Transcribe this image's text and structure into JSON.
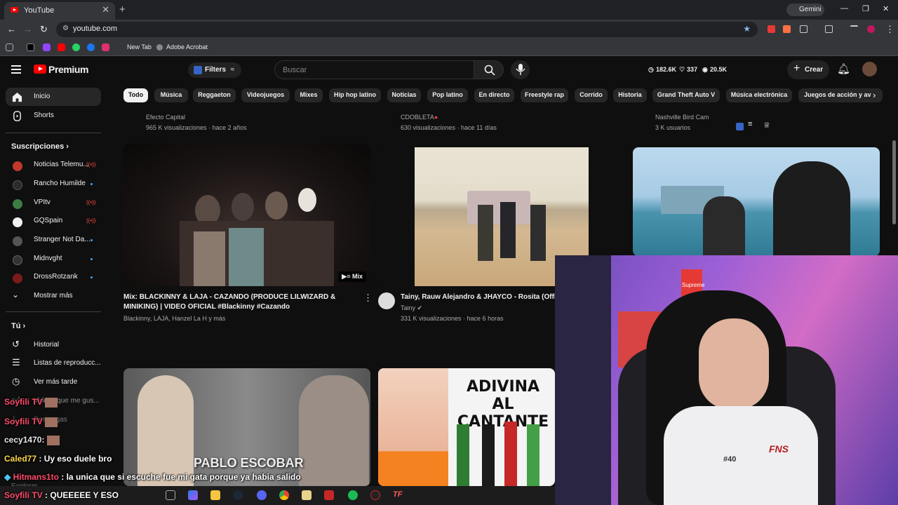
{
  "browser": {
    "tab_title": "YouTube",
    "tab_close": "✕",
    "new_tab": "+",
    "gemini": "Gemini",
    "url": "youtube.com",
    "bookmarks": [
      "New Tab",
      "Adobe Acrobat"
    ],
    "win_min": "—",
    "win_max": "❐",
    "win_close": "✕"
  },
  "header": {
    "logo_text": "Premium",
    "filters": "Filters",
    "search_placeholder": "Buscar",
    "stats": [
      "182.6K",
      "337",
      "20.5K"
    ],
    "create": "Crear"
  },
  "sidebar": {
    "main": [
      {
        "label": "Inicio",
        "icon": "home-icon"
      },
      {
        "label": "Shorts",
        "icon": "shorts-icon"
      }
    ],
    "subs_title": "Suscripciones",
    "subs": [
      {
        "label": "Noticias Telemu...",
        "status": "live",
        "color": "#c0392b"
      },
      {
        "label": "Rancho Humilde",
        "status": "new",
        "color": "#2b2b2b"
      },
      {
        "label": "VPItv",
        "status": "live",
        "color": "#3a7d44"
      },
      {
        "label": "GQSpain",
        "status": "live",
        "color": "#f1f1f1"
      },
      {
        "label": "Stranger Not Da...",
        "status": "new",
        "color": "#555"
      },
      {
        "label": "Midnvght",
        "status": "new",
        "color": "#333"
      },
      {
        "label": "DrossRotzank",
        "status": "new",
        "color": "#7a1b1b"
      }
    ],
    "more": "Mostrar más",
    "you_title": "Tú",
    "you": [
      {
        "label": "Historial",
        "icon": "history-icon"
      },
      {
        "label": "Listas de reproducc...",
        "icon": "playlists-icon"
      },
      {
        "label": "Ver más tarde",
        "icon": "watch-later-icon"
      },
      {
        "label": "Videos que me gus...",
        "icon": "liked-icon"
      },
      {
        "label": "Descargas",
        "icon": "downloads-icon"
      },
      {
        "label": "Explorar",
        "icon": "explore-icon"
      }
    ]
  },
  "chips": [
    "Todo",
    "Música",
    "Reggaeton",
    "Videojuegos",
    "Mixes",
    "Hip hop latino",
    "Noticias",
    "Pop latino",
    "En directo",
    "Freestyle rap",
    "Corrido",
    "Historia",
    "Grand Theft Auto V",
    "Música electrónica",
    "Juegos de acción y av"
  ],
  "top_row": [
    {
      "channel": "Efecto Capital",
      "meta": "965 K visualizaciones · hace 2 años"
    },
    {
      "channel": "CDOBLETA",
      "meta": "630 visualizaciones · hace 11 días"
    },
    {
      "channel": "Nashville Bird Cam",
      "meta": "3 K usuarios"
    }
  ],
  "videos": [
    {
      "title": "Mix: BLACKINNY & LAJA - CAZANDO (PRODUCE LILWIZARD & MINIKING) | VIDEO OFICIAL #Blackinny #Cazando",
      "channel": "Blackinny, LAJA, Hanzel La H y más",
      "badge": "Mix"
    },
    {
      "title": "Tainy, Rauw Alejandro & JHAYCO - Rosita (Offi",
      "channel": "Tainy",
      "meta": "331 K visualizaciones · hace 6 horas"
    }
  ],
  "thumb_text": {
    "escobar": "PABLO ESCOBAR",
    "adivina": "ADIVINA AL CANTANTE"
  },
  "chat": [
    {
      "user": "Soyfili TV",
      "msg": ""
    },
    {
      "user": "Soyfili TV",
      "msg": ""
    },
    {
      "user": "cecy1470",
      "msg": ":"
    },
    {
      "user": "Caled77",
      "msg": ": Uy eso duele bro"
    },
    {
      "user": "Hitmans1to",
      "msg": ": la unica que si escuche fue mi gata porque ya habia salido"
    },
    {
      "user": "Soyfili TV",
      "msg": ": QUEEEEE Y ESO"
    }
  ],
  "cam_text": {
    "supreme": "Supreme",
    "jersey": "FNS",
    "number": "#40"
  }
}
